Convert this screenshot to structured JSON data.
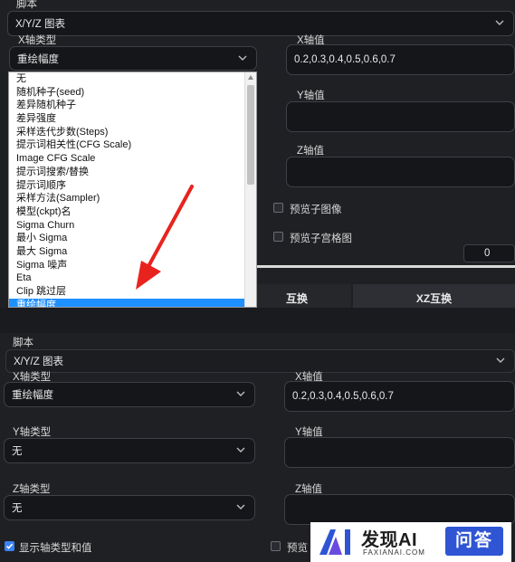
{
  "top": {
    "script_label": "脚本",
    "script_value": "X/Y/Z 图表",
    "x_type_label": "X轴类型",
    "x_type_value": "重绘幅度",
    "x_values_label": "X轴值",
    "x_values_value": "0.2,0.3,0.4,0.5,0.6,0.7",
    "y_values_label": "Y轴值",
    "z_values_label": "Z轴值",
    "preview_sub_image": "预览子图像",
    "preview_sub_grid": "预览子宫格图",
    "margin_value": "0",
    "swap_xy_partial": "互换",
    "swap_xz": "XZ互换",
    "dropdown_options": [
      "无",
      "随机种子(seed)",
      "差异随机种子",
      "差异强度",
      "采样迭代步数(Steps)",
      "提示词相关性(CFG Scale)",
      "Image CFG Scale",
      "提示词搜索/替换",
      "提示词顺序",
      "采样方法(Sampler)",
      "模型(ckpt)名",
      "Sigma Churn",
      "最小 Sigma",
      "最大 Sigma",
      "Sigma 噪声",
      "Eta",
      "Clip 跳过层",
      "重绘幅度"
    ]
  },
  "bottom": {
    "script_label": "脚本",
    "script_value": "X/Y/Z 图表",
    "x_type_label": "X轴类型",
    "x_type_value": "重绘幅度",
    "x_values_label": "X轴值",
    "x_values_value": "0.2,0.3,0.4,0.5,0.6,0.7",
    "y_type_label": "Y轴类型",
    "y_type_value": "无",
    "y_values_label": "Y轴值",
    "z_type_label": "Z轴类型",
    "z_type_value": "无",
    "z_values_label": "Z轴值",
    "show_axis_label": "显示轴类型和值",
    "preview_partial": "预览"
  },
  "watermark": {
    "brand": "发现AI",
    "domain": "FAXIANAI.COM",
    "badge": "问答"
  },
  "colors": {
    "accent": "#1e90ff",
    "arrow": "#e8231e",
    "background": "#1f2023"
  }
}
